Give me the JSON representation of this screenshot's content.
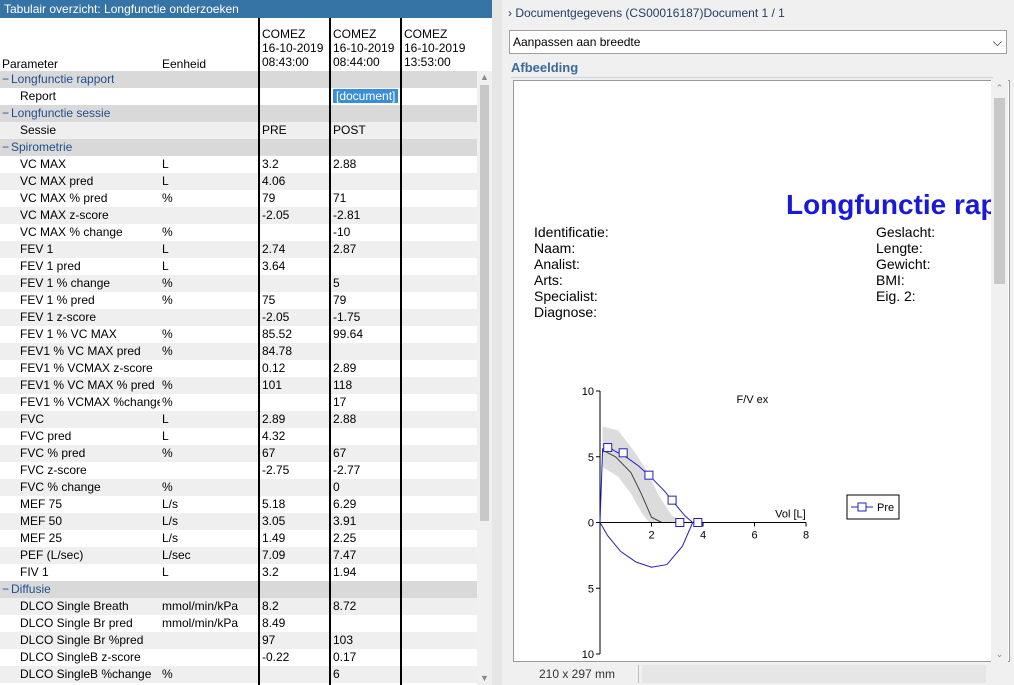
{
  "left_panel": {
    "title": "Tabulair overzicht: Longfunctie onderzoeken",
    "col_parameter": "Parameter",
    "col_unit": "Eenheid",
    "sessions": [
      {
        "name": "COMEZ",
        "date": "16-10-2019",
        "time": "08:43:00"
      },
      {
        "name": "COMEZ",
        "date": "16-10-2019",
        "time": "08:44:00"
      },
      {
        "name": "COMEZ",
        "date": "16-10-2019",
        "time": "13:53:00"
      }
    ],
    "rows": [
      {
        "type": "group",
        "label": "Longfunctie rapport"
      },
      {
        "type": "row",
        "p": "Report",
        "u": "",
        "v1": "",
        "v2": "[document]",
        "v3": ""
      },
      {
        "type": "group",
        "label": "Longfunctie sessie"
      },
      {
        "type": "row",
        "p": "Sessie",
        "u": "",
        "v1": "PRE",
        "v2": "POST",
        "v3": ""
      },
      {
        "type": "group",
        "label": "Spirometrie"
      },
      {
        "type": "row",
        "p": "VC MAX",
        "u": "L",
        "v1": "3.2",
        "v2": "2.88",
        "v3": ""
      },
      {
        "type": "row",
        "p": "VC MAX pred",
        "u": "L",
        "v1": "4.06",
        "v2": "",
        "v3": ""
      },
      {
        "type": "row",
        "p": "VC MAX % pred",
        "u": "%",
        "v1": "79",
        "v2": "71",
        "v3": ""
      },
      {
        "type": "row",
        "p": "VC MAX z-score",
        "u": "",
        "v1": "-2.05",
        "v2": "-2.81",
        "v3": ""
      },
      {
        "type": "row",
        "p": "VC MAX % change",
        "u": "%",
        "v1": "",
        "v2": "-10",
        "v3": ""
      },
      {
        "type": "row",
        "p": "FEV 1",
        "u": "L",
        "v1": "2.74",
        "v2": "2.87",
        "v3": ""
      },
      {
        "type": "row",
        "p": "FEV 1 pred",
        "u": "L",
        "v1": "3.64",
        "v2": "",
        "v3": ""
      },
      {
        "type": "row",
        "p": "FEV 1 % change",
        "u": "%",
        "v1": "",
        "v2": "5",
        "v3": ""
      },
      {
        "type": "row",
        "p": "FEV 1 % pred",
        "u": "%",
        "v1": "75",
        "v2": "79",
        "v3": ""
      },
      {
        "type": "row",
        "p": "FEV 1 z-score",
        "u": "",
        "v1": "-2.05",
        "v2": "-1.75",
        "v3": ""
      },
      {
        "type": "row",
        "p": "FEV 1 % VC MAX",
        "u": "%",
        "v1": "85.52",
        "v2": "99.64",
        "v3": ""
      },
      {
        "type": "row",
        "p": "FEV1 % VC MAX pred",
        "u": "%",
        "v1": "84.78",
        "v2": "",
        "v3": ""
      },
      {
        "type": "row",
        "p": "FEV1 % VCMAX z-score",
        "u": "",
        "v1": "0.12",
        "v2": "2.89",
        "v3": ""
      },
      {
        "type": "row",
        "p": "FEV1 % VC MAX % pred",
        "u": "%",
        "v1": "101",
        "v2": "118",
        "v3": ""
      },
      {
        "type": "row",
        "p": "FEV1 % VCMAX %change",
        "u": "%",
        "v1": "",
        "v2": "17",
        "v3": ""
      },
      {
        "type": "row",
        "p": "FVC",
        "u": "L",
        "v1": "2.89",
        "v2": "2.88",
        "v3": ""
      },
      {
        "type": "row",
        "p": "FVC pred",
        "u": "L",
        "v1": "4.32",
        "v2": "",
        "v3": ""
      },
      {
        "type": "row",
        "p": "FVC % pred",
        "u": "%",
        "v1": "67",
        "v2": "67",
        "v3": ""
      },
      {
        "type": "row",
        "p": "FVC z-score",
        "u": "",
        "v1": "-2.75",
        "v2": "-2.77",
        "v3": ""
      },
      {
        "type": "row",
        "p": "FVC % change",
        "u": "%",
        "v1": "",
        "v2": "0",
        "v3": ""
      },
      {
        "type": "row",
        "p": "MEF 75",
        "u": "L/s",
        "v1": "5.18",
        "v2": "6.29",
        "v3": ""
      },
      {
        "type": "row",
        "p": "MEF 50",
        "u": "L/s",
        "v1": "3.05",
        "v2": "3.91",
        "v3": ""
      },
      {
        "type": "row",
        "p": "MEF 25",
        "u": "L/s",
        "v1": "1.49",
        "v2": "2.25",
        "v3": ""
      },
      {
        "type": "row",
        "p": "PEF (L/sec)",
        "u": "L/sec",
        "v1": "7.09",
        "v2": "7.47",
        "v3": ""
      },
      {
        "type": "row",
        "p": "FIV 1",
        "u": "L",
        "v1": "3.2",
        "v2": "1.94",
        "v3": ""
      },
      {
        "type": "group",
        "label": "Diffusie"
      },
      {
        "type": "row",
        "p": "DLCO Single Breath",
        "u": "mmol/min/kPa",
        "v1": "8.2",
        "v2": "8.72",
        "v3": ""
      },
      {
        "type": "row",
        "p": "DLCO Single Br pred",
        "u": "mmol/min/kPa",
        "v1": "8.49",
        "v2": "",
        "v3": ""
      },
      {
        "type": "row",
        "p": "DLCO Single Br %pred",
        "u": "",
        "v1": "97",
        "v2": "103",
        "v3": ""
      },
      {
        "type": "row",
        "p": "DLCO SingleB z-score",
        "u": "",
        "v1": "-0.22",
        "v2": "0.17",
        "v3": ""
      },
      {
        "type": "row",
        "p": "DLCO SingleB %change",
        "u": "%",
        "v1": "",
        "v2": "6",
        "v3": ""
      }
    ]
  },
  "right_panel": {
    "header": "Documentgegevens (CS00016187)Document 1 / 1",
    "fit_option": "Aanpassen aan breedte",
    "section_label": "Afbeelding",
    "page_size": "210 x 297 mm",
    "document": {
      "title": "Longfunctie rap",
      "left_fields": [
        "Identificatie:",
        "Naam:",
        "Analist:",
        "Arts:",
        "Specialist:",
        "Diagnose:"
      ],
      "right_fields": [
        "Geslacht:",
        "Lengte:",
        "Gewicht:",
        "BMI:",
        "Eig. 2:"
      ],
      "chart_title": "F/V ex",
      "x_label": "Vol [L]",
      "legend": "Pre"
    }
  },
  "chart_data": {
    "type": "line",
    "title": "F/V ex",
    "xlabel": "Vol [L]",
    "ylabel": "",
    "xlim": [
      0,
      8
    ],
    "ylim": [
      -10,
      10
    ],
    "x_ticks": [
      0,
      2,
      4,
      6,
      8
    ],
    "y_ticks": [
      10,
      5,
      0,
      5,
      10
    ],
    "legend": "right",
    "series": [
      {
        "name": "Pre",
        "color": "#2020c0",
        "expiratory": [
          [
            0,
            0
          ],
          [
            0.1,
            5.6
          ],
          [
            0.3,
            5.8
          ],
          [
            0.6,
            5.4
          ],
          [
            1.0,
            5.0
          ],
          [
            1.5,
            4.3
          ],
          [
            2.0,
            3.4
          ],
          [
            2.5,
            2.4
          ],
          [
            3.0,
            1.2
          ],
          [
            3.3,
            0.5
          ],
          [
            3.6,
            0.0
          ]
        ],
        "inspiratory": [
          [
            3.6,
            0.0
          ],
          [
            3.2,
            -1.8
          ],
          [
            2.6,
            -3.2
          ],
          [
            2.0,
            -3.4
          ],
          [
            1.4,
            -3.0
          ],
          [
            0.8,
            -2.2
          ],
          [
            0.3,
            -1.0
          ],
          [
            0,
            0
          ]
        ],
        "markers": [
          [
            0.3,
            5.7
          ],
          [
            0.9,
            5.3
          ],
          [
            1.9,
            3.6
          ],
          [
            2.8,
            1.7
          ],
          [
            3.1,
            0.0
          ],
          [
            3.8,
            0.0
          ]
        ]
      },
      {
        "name": "predicted",
        "color": "#444444",
        "line": [
          [
            0.1,
            5.5
          ],
          [
            0.6,
            5.0
          ],
          [
            1.2,
            3.8
          ],
          [
            1.6,
            2.2
          ],
          [
            2.0,
            0.4
          ],
          [
            2.4,
            0.0
          ]
        ],
        "band_upper": [
          [
            0.1,
            7.3
          ],
          [
            0.7,
            7.0
          ],
          [
            1.3,
            5.5
          ],
          [
            1.8,
            4.0
          ],
          [
            2.3,
            2.0
          ],
          [
            2.8,
            0.5
          ],
          [
            3.3,
            0.0
          ]
        ],
        "band_lower": [
          [
            0.1,
            4.2
          ],
          [
            0.7,
            3.5
          ],
          [
            1.2,
            2.2
          ],
          [
            1.6,
            0.8
          ],
          [
            1.9,
            0.0
          ]
        ]
      }
    ]
  }
}
